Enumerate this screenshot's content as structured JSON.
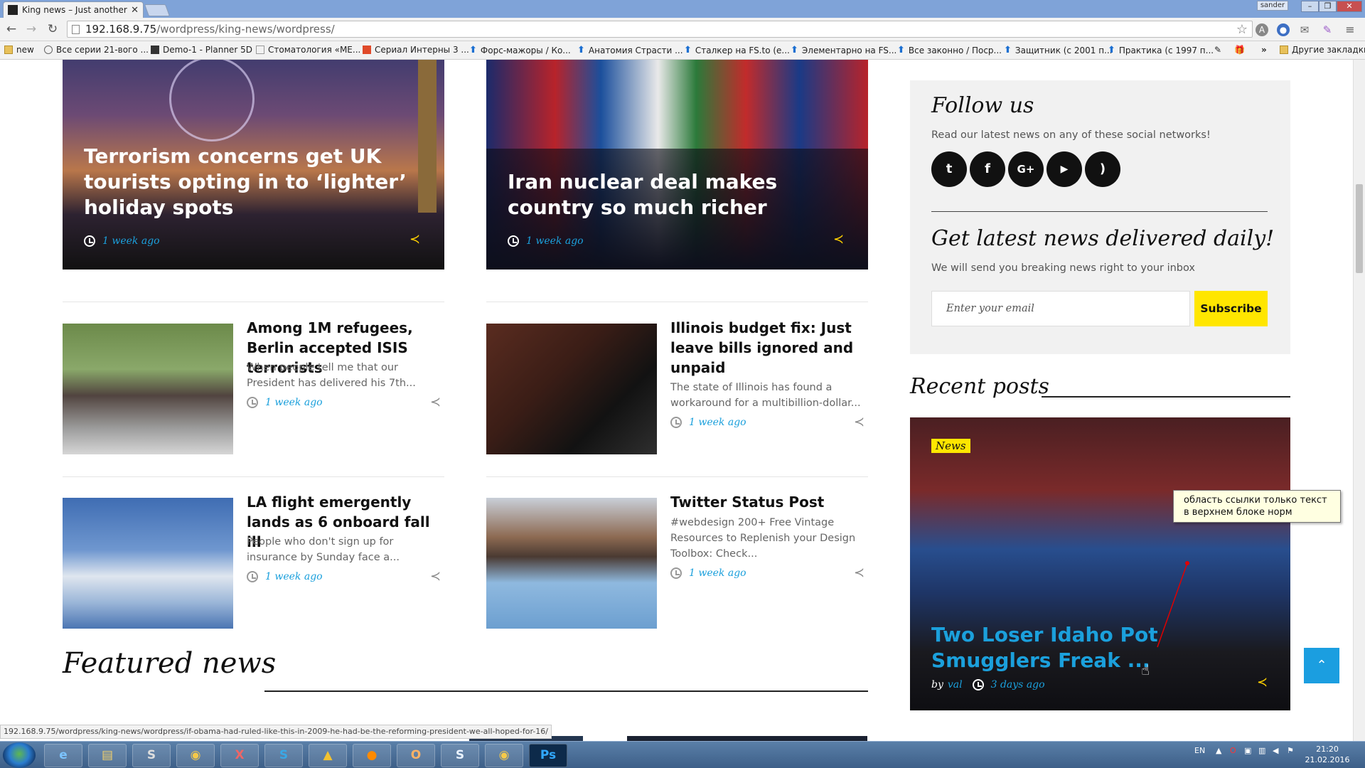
{
  "browser": {
    "tab_title": "King news – Just another \\",
    "user_chip": "sander",
    "url_host": "192.168.9.75",
    "url_path": "/wordpress/king-news/wordpress/",
    "bookmarks": [
      {
        "label": "new",
        "kind": "folder"
      },
      {
        "label": "Все серии 21-вого ...",
        "kind": "site"
      },
      {
        "label": "Demo-1 - Planner 5D",
        "kind": "site"
      },
      {
        "label": "Стоматология «МЕ...",
        "kind": "site"
      },
      {
        "label": "Сериал Интерны 3 ...",
        "kind": "site"
      },
      {
        "label": "Форс-мажоры / Ко...",
        "kind": "arrow"
      },
      {
        "label": "Анатомия Страсти ...",
        "kind": "arrow"
      },
      {
        "label": "Сталкер на FS.to (е...",
        "kind": "arrow"
      },
      {
        "label": "Элементарно на FS...",
        "kind": "arrow"
      },
      {
        "label": "Все законно / Поср...",
        "kind": "arrow"
      },
      {
        "label": "Защитник (с 2001 п...",
        "kind": "arrow"
      },
      {
        "label": "Практика (с 1997 п...",
        "kind": "arrow"
      }
    ],
    "bookmarks_more": "»",
    "other_bookmarks": "Другие закладки",
    "status_url": "192.168.9.75/wordpress/king-news/wordpress/if-obama-had-ruled-like-this-in-2009-he-had-be-the-reforming-president-we-all-hoped-for-16/"
  },
  "posts": {
    "hero": [
      {
        "title": "Terrorism concerns get UK tourists opting in to ‘lighter’ holiday spots",
        "date": "1 week ago"
      },
      {
        "title": "Iran nuclear deal makes country so much richer",
        "date": "1 week ago"
      }
    ],
    "cards": [
      {
        "title": "Among 1M refugees, Berlin accepted ISIS terrorists",
        "excerpt": "When people tell me that our President has delivered his 7th...",
        "date": "1 week ago"
      },
      {
        "title": "Illinois budget fix: Just leave bills ignored and unpaid",
        "excerpt": "The state of Illinois has found a workaround for a multibillion-dollar...",
        "date": "1 week ago"
      },
      {
        "title": "LA flight emergently lands as 6 onboard fall ill",
        "excerpt": "People who don't sign up for insurance by Sunday face a...",
        "date": "1 week ago"
      },
      {
        "title": "Twitter Status Post",
        "excerpt": "#webdesign 200+ Free Vintage Resources to Replenish your Design Toolbox: Check...",
        "date": "1 week ago"
      }
    ],
    "featured_heading": "Featured news"
  },
  "sidebar": {
    "follow_title": "Follow us",
    "follow_text": "Read our latest news on any of these social networks!",
    "social_icons": [
      "twitter-icon",
      "facebook-icon",
      "google-plus-icon",
      "youtube-icon",
      "rss-icon"
    ],
    "newsletter_title": "Get latest news delivered daily!",
    "newsletter_text": "We will send you breaking news right to your inbox",
    "email_placeholder": "Enter your email",
    "subscribe_label": "Subscribe",
    "recent_heading": "Recent posts",
    "recent": {
      "badge": "News",
      "title": "Two Loser Idaho Pot Smugglers Freak ...",
      "by_prefix": "by",
      "author": "val",
      "date": "3 days ago"
    }
  },
  "tooltip": {
    "line1": "область ссылки только текст",
    "line2": "в верхнем блоке норм"
  },
  "taskbar": {
    "lang": "EN",
    "time": "21:20",
    "date": "21.02.2016"
  },
  "colors": {
    "accent_blue": "#1ba0dc",
    "accent_yellow": "#ffe600"
  }
}
